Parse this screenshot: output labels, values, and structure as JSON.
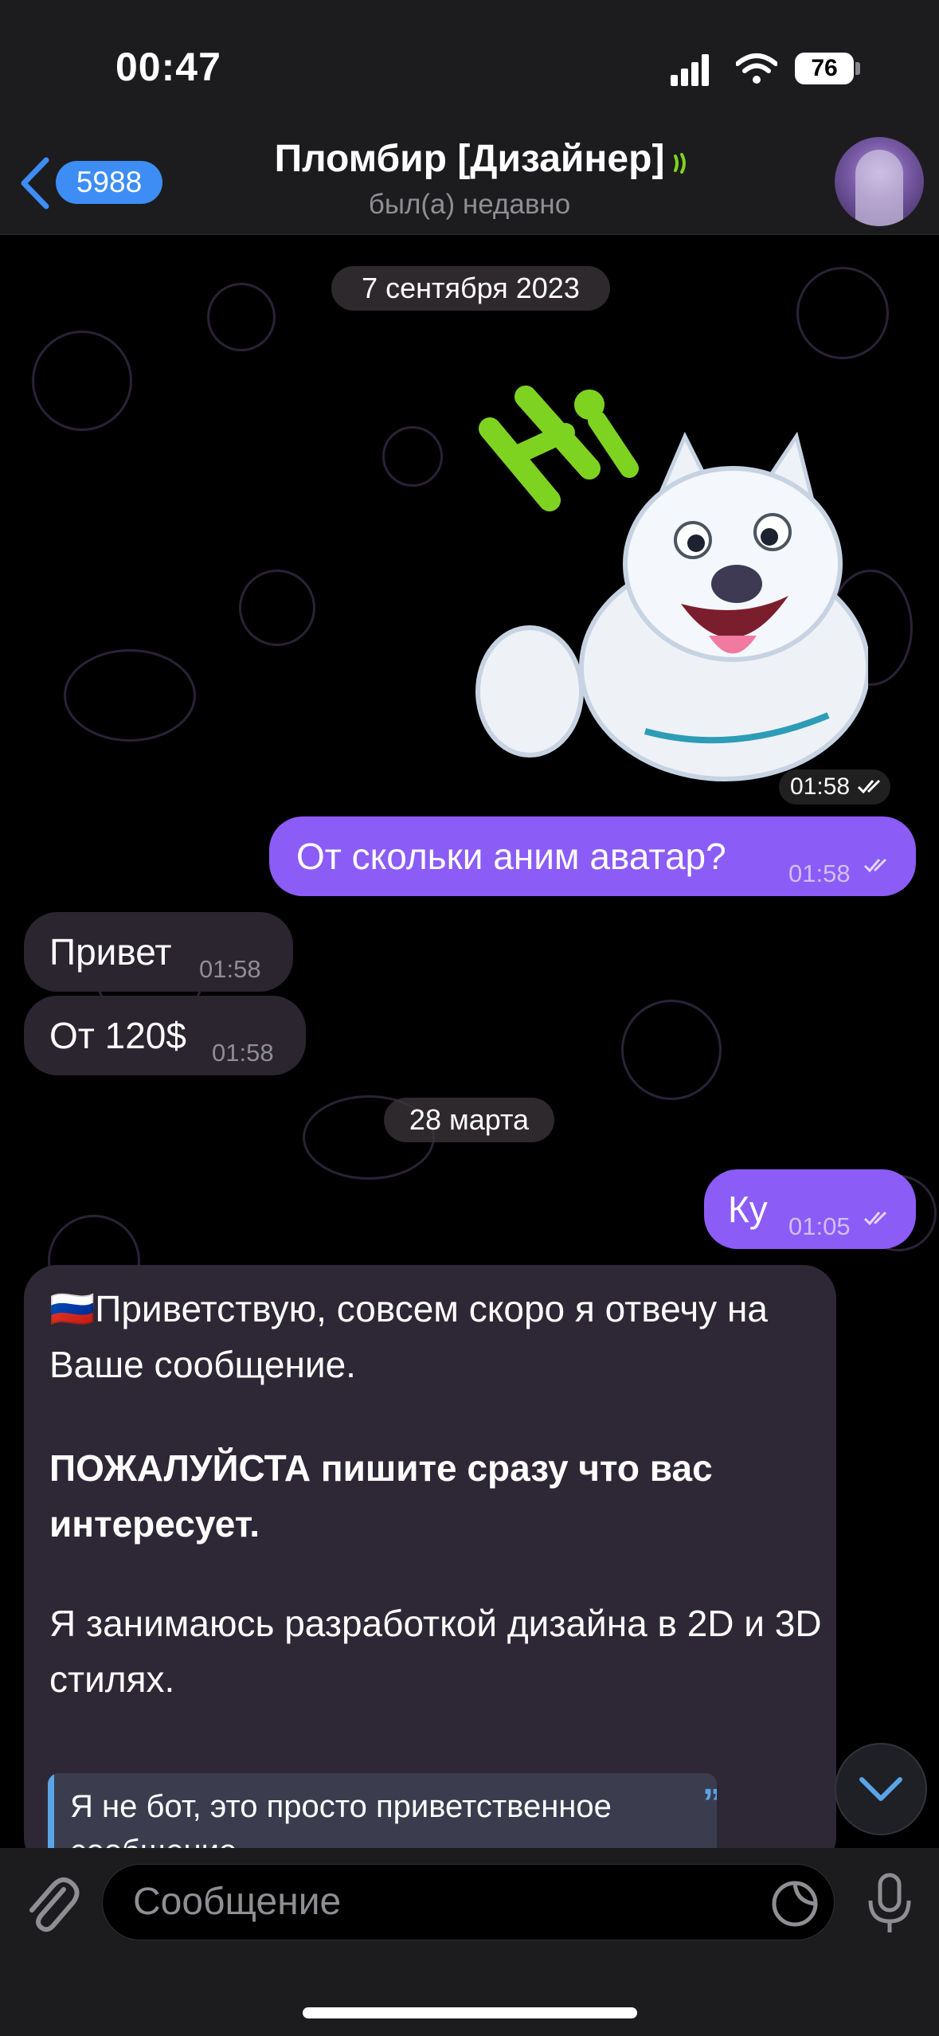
{
  "status_bar": {
    "time": "00:47",
    "battery": "76"
  },
  "header": {
    "back_badge": "5988",
    "title": "Пломбир [Дизайнер]",
    "subtitle": "был(а) недавно"
  },
  "messages": {
    "date1": "7 сентября 2023",
    "sticker_time": "01:58",
    "m1": {
      "text": "От скольки аним аватар?",
      "time": "01:58"
    },
    "m2": {
      "text": "Привет",
      "time": "01:58"
    },
    "m3": {
      "text": "От 120$",
      "time": "01:58"
    },
    "date2": "28 марта",
    "m4": {
      "text": "Ку",
      "time": "01:05"
    },
    "long": {
      "flag": "🇷🇺",
      "line1": "Приветствую, совсем скоро я отвечу на Ваше сообщение.",
      "bold": "ПОЖАЛУЙСТА пишите сразу что вас интересует.",
      "line3": "Я занимаюсь разработкой дизайна в 2D и 3D стилях.",
      "quote": "Я не бот, это просто приветственное сообщение."
    }
  },
  "composer": {
    "placeholder": "Сообщение"
  },
  "colors": {
    "outgoing": "#8b5cf6",
    "incoming": "#2b2530",
    "accent": "#3d8df5"
  }
}
